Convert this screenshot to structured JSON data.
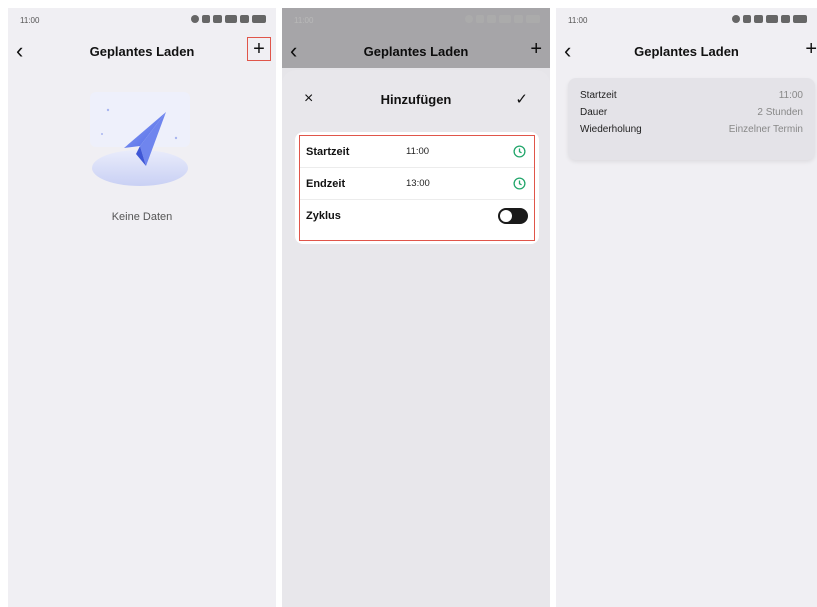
{
  "status_bar": {
    "time": "11:00"
  },
  "screen1": {
    "title": "Geplantes Laden",
    "back_icon": "‹",
    "add_icon": "+",
    "empty_text": "Keine Daten"
  },
  "screen2": {
    "title": "Geplantes Laden",
    "back_icon": "‹",
    "add_icon": "+",
    "sheet": {
      "title": "Hinzufügen",
      "close_icon": "×",
      "confirm_icon": "✓",
      "rows": [
        {
          "label": "Startzeit",
          "value": "11:00"
        },
        {
          "label": "Endzeit",
          "value": "13:00"
        },
        {
          "label": "Zyklus",
          "value": ""
        }
      ]
    }
  },
  "screen3": {
    "title": "Geplantes Laden",
    "back_icon": "‹",
    "add_icon": "+",
    "schedule": [
      {
        "key": "Startzeit",
        "value": "11:00"
      },
      {
        "key": "Dauer",
        "value": "2 Stunden"
      },
      {
        "key": "Wiederholung",
        "value": "Einzelner Termin"
      }
    ]
  },
  "colors": {
    "accent_green": "#22a66b",
    "highlight_red": "#e0554a"
  }
}
